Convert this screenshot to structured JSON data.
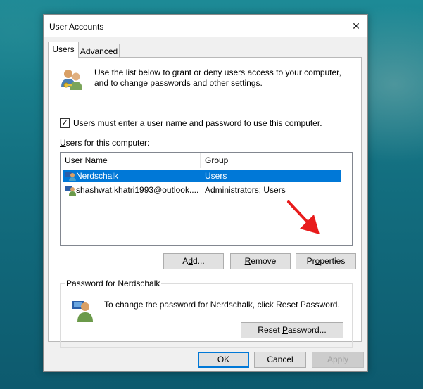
{
  "window": {
    "title": "User Accounts",
    "close_glyph": "✕"
  },
  "tabs": [
    {
      "label": "Users",
      "active": true
    },
    {
      "label": "Advanced",
      "active": false
    }
  ],
  "intro_text": "Use the list below to grant or deny users access to your computer, and to change passwords and other settings.",
  "require_login": {
    "checked": true,
    "check_glyph": "✓",
    "label_prefix": "Users must ",
    "label_accel": "e",
    "label_suffix": "nter a user name and password to use this computer."
  },
  "users_list": {
    "label_accel": "U",
    "label_suffix": "sers for this computer:",
    "columns": [
      "User Name",
      "Group"
    ],
    "rows": [
      {
        "name": "Nerdschalk",
        "group": "Users",
        "selected": true
      },
      {
        "name": "shashwat.khatri1993@outlook....",
        "group": "Administrators; Users",
        "selected": false
      }
    ]
  },
  "buttons": {
    "add": {
      "prefix": "A",
      "accel": "d",
      "suffix": "d..."
    },
    "remove": {
      "prefix": "",
      "accel": "R",
      "suffix": "emove"
    },
    "properties": {
      "prefix": "Pr",
      "accel": "o",
      "suffix": "perties"
    }
  },
  "password_group": {
    "title": "Password for Nerdschalk",
    "text": "To change the password for Nerdschalk, click Reset Password.",
    "reset_button": {
      "prefix": "Reset ",
      "accel": "P",
      "suffix": "assword..."
    }
  },
  "footer": {
    "ok": "OK",
    "cancel": "Cancel",
    "apply": "Apply"
  },
  "colors": {
    "selection": "#0078d7",
    "accent_arrow": "#e81b1b",
    "default_button_border": "#0078d7"
  }
}
